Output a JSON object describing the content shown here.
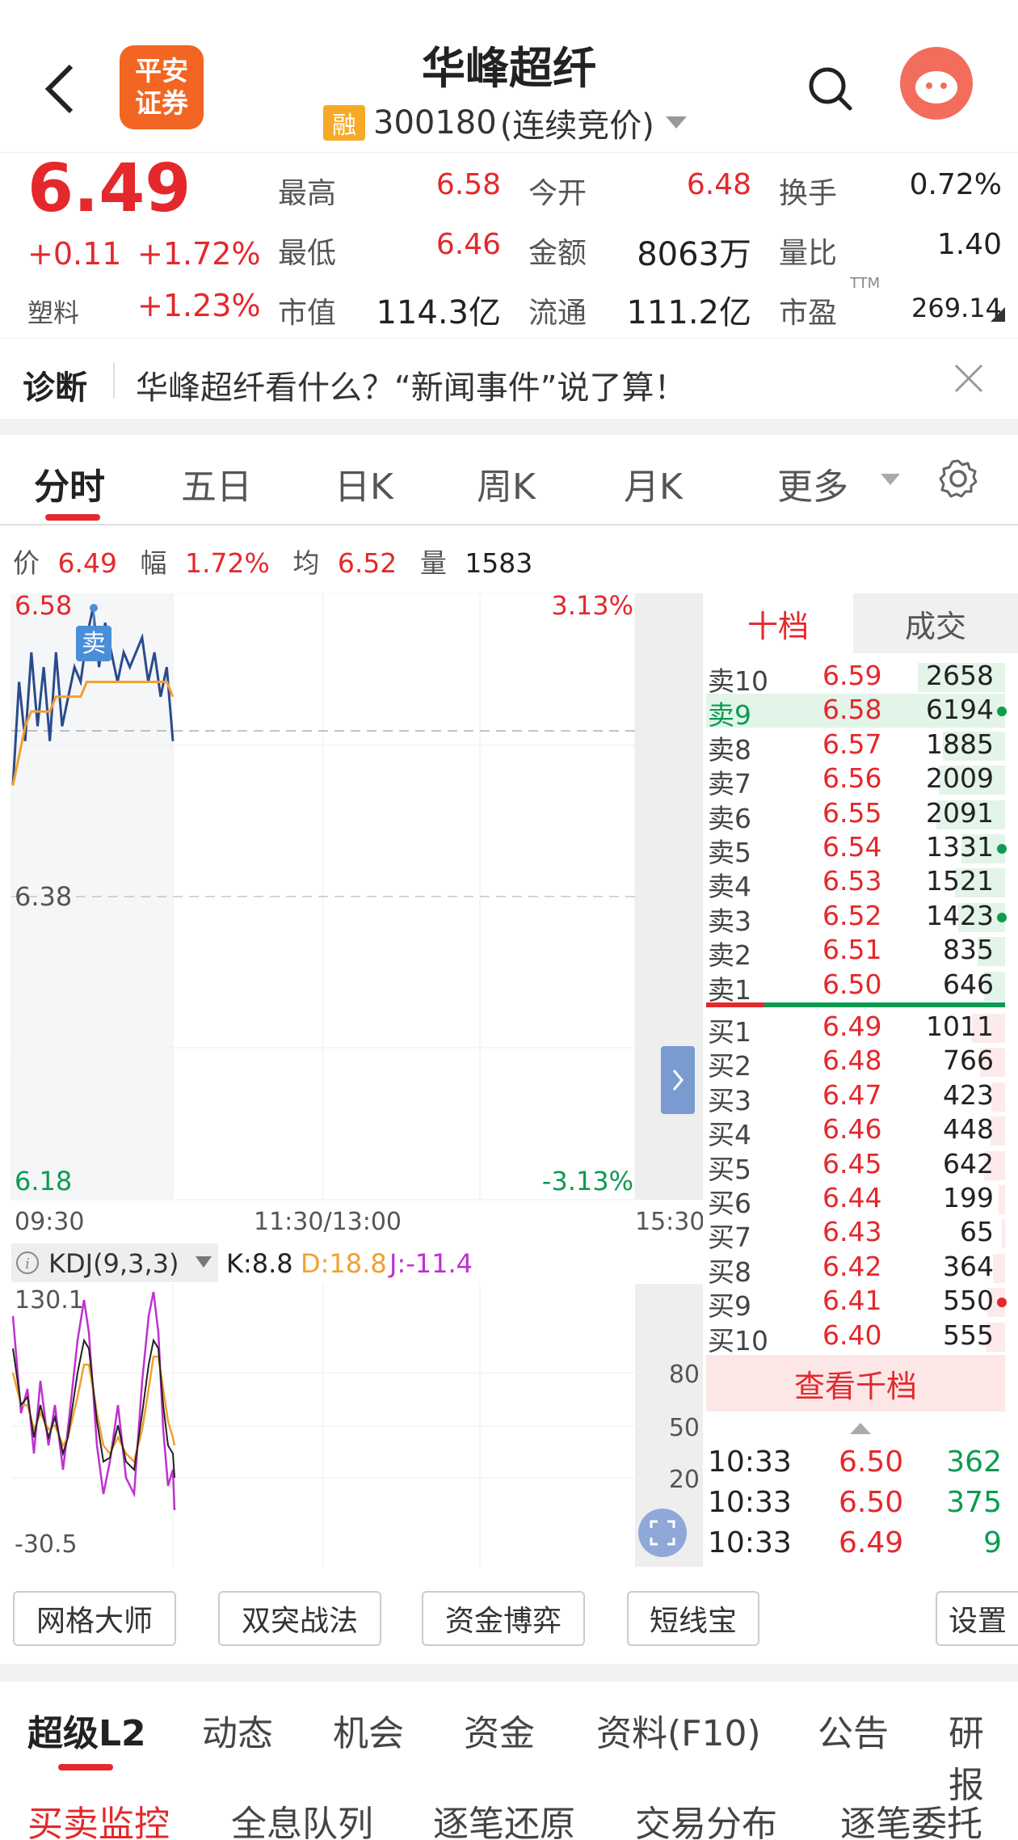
{
  "header": {
    "back_icon": "chevron-left-icon",
    "logo_line1": "平安",
    "logo_line2": "证券",
    "stock_name": "华峰超纤",
    "badge": "融",
    "code": "300180",
    "status": "(连续竞价)",
    "search_icon": "search-icon",
    "avatar_icon": "assistant-avatar-icon"
  },
  "quote": {
    "price": "6.49",
    "change": "+0.11",
    "change_pct": "+1.72%",
    "sector": "塑料",
    "sector_pct": "+1.23%",
    "stats": [
      {
        "label": "最高",
        "value": "6.58",
        "color": "red"
      },
      {
        "label": "今开",
        "value": "6.48",
        "color": "red"
      },
      {
        "label": "换手",
        "value": "0.72%",
        "color": "black"
      },
      {
        "label": "最低",
        "value": "6.46",
        "color": "red"
      },
      {
        "label": "金额",
        "value": "8063万",
        "color": "black"
      },
      {
        "label": "量比",
        "value": "1.40",
        "color": "black"
      },
      {
        "label": "市值",
        "value": "114.3亿",
        "color": "black"
      },
      {
        "label": "流通",
        "value": "111.2亿",
        "color": "black"
      },
      {
        "label": "市盈",
        "value": "269.14",
        "color": "black",
        "sup": "TTM"
      }
    ]
  },
  "diagnosis": {
    "label": "诊断",
    "text": "华峰超纤看什么？“新闻事件”说了算！",
    "close_icon": "close-icon"
  },
  "tabs": {
    "items": [
      "分时",
      "五日",
      "日K",
      "周K",
      "月K",
      "更多"
    ],
    "active": "分时",
    "settings_icon": "gear-icon"
  },
  "info_bar": {
    "price_label": "价",
    "price": "6.49",
    "amp_label": "幅",
    "amp": "1.72%",
    "avg_label": "均",
    "avg": "6.52",
    "vol_label": "量",
    "vol": "1583"
  },
  "chart_labels": {
    "y_top": "6.58",
    "y_mid": "6.38",
    "y_bottom": "6.18",
    "pct_top": "3.13%",
    "pct_bottom": "-3.13%",
    "x_start": "09:30",
    "x_mid": "11:30/13:00",
    "x_end": "15:30",
    "sell_marker": "卖"
  },
  "chart_data": {
    "type": "line",
    "ylim": [
      6.18,
      6.58
    ],
    "series": [
      {
        "name": "价",
        "color": "#2b4a8b",
        "values": [
          6.46,
          6.53,
          6.49,
          6.55,
          6.5,
          6.54,
          6.49,
          6.55,
          6.5,
          6.52,
          6.54,
          6.53,
          6.56,
          6.58,
          6.54,
          6.57,
          6.55,
          6.53,
          6.55,
          6.54,
          6.55,
          6.56,
          6.53,
          6.55,
          6.52,
          6.54,
          6.49
        ]
      },
      {
        "name": "均",
        "color": "#f0a030",
        "values": [
          6.46,
          6.48,
          6.5,
          6.51,
          6.51,
          6.51,
          6.51,
          6.52,
          6.52,
          6.52,
          6.52,
          6.52,
          6.53,
          6.53,
          6.53,
          6.53,
          6.53,
          6.53,
          6.53,
          6.53,
          6.53,
          6.53,
          6.53,
          6.53,
          6.53,
          6.53,
          6.52
        ]
      }
    ]
  },
  "kdj": {
    "label": "KDJ(9,3,3)",
    "k": "K:8.8",
    "d": "D:18.8",
    "j": "J:-11.4",
    "top": "130.1",
    "bottom": "-30.5",
    "levels": [
      "80",
      "50",
      "20"
    ],
    "colors": {
      "k": "#222222",
      "d": "#f0a030",
      "j": "#c030d0"
    }
  },
  "order_book": {
    "tab_active": "十档",
    "tab_other": "成交",
    "asks": [
      {
        "label": "卖10",
        "price": "6.59",
        "vol": "2658"
      },
      {
        "label": "卖9",
        "price": "6.58",
        "vol": "6194"
      },
      {
        "label": "卖8",
        "price": "6.57",
        "vol": "1885"
      },
      {
        "label": "卖7",
        "price": "6.56",
        "vol": "2009"
      },
      {
        "label": "卖6",
        "price": "6.55",
        "vol": "2091"
      },
      {
        "label": "卖5",
        "price": "6.54",
        "vol": "1331"
      },
      {
        "label": "卖4",
        "price": "6.53",
        "vol": "1521"
      },
      {
        "label": "卖3",
        "price": "6.52",
        "vol": "1423"
      },
      {
        "label": "卖2",
        "price": "6.51",
        "vol": "835"
      },
      {
        "label": "卖1",
        "price": "6.50",
        "vol": "646"
      }
    ],
    "bids": [
      {
        "label": "买1",
        "price": "6.49",
        "vol": "1011"
      },
      {
        "label": "买2",
        "price": "6.48",
        "vol": "766"
      },
      {
        "label": "买3",
        "price": "6.47",
        "vol": "423"
      },
      {
        "label": "买4",
        "price": "6.46",
        "vol": "448"
      },
      {
        "label": "买5",
        "price": "6.45",
        "vol": "642"
      },
      {
        "label": "买6",
        "price": "6.44",
        "vol": "199"
      },
      {
        "label": "买7",
        "price": "6.43",
        "vol": "65"
      },
      {
        "label": "买8",
        "price": "6.42",
        "vol": "364"
      },
      {
        "label": "买9",
        "price": "6.41",
        "vol": "550"
      },
      {
        "label": "买10",
        "price": "6.40",
        "vol": "555"
      }
    ],
    "more_button": "查看千档",
    "trades": [
      {
        "time": "10:33",
        "price": "6.50",
        "vol": "362"
      },
      {
        "time": "10:33",
        "price": "6.50",
        "vol": "375"
      },
      {
        "time": "10:33",
        "price": "6.49",
        "vol": "9"
      }
    ]
  },
  "tool_buttons": [
    "网格大师",
    "双突战法",
    "资金博弈",
    "短线宝",
    "设置"
  ],
  "bottom_tabs": [
    "超级L2",
    "动态",
    "机会",
    "资金",
    "资料(F10)",
    "公告",
    "研报"
  ],
  "sub_tabs": [
    "买卖监控",
    "全息队列",
    "逐笔还原",
    "交易分布",
    "逐笔委托"
  ]
}
